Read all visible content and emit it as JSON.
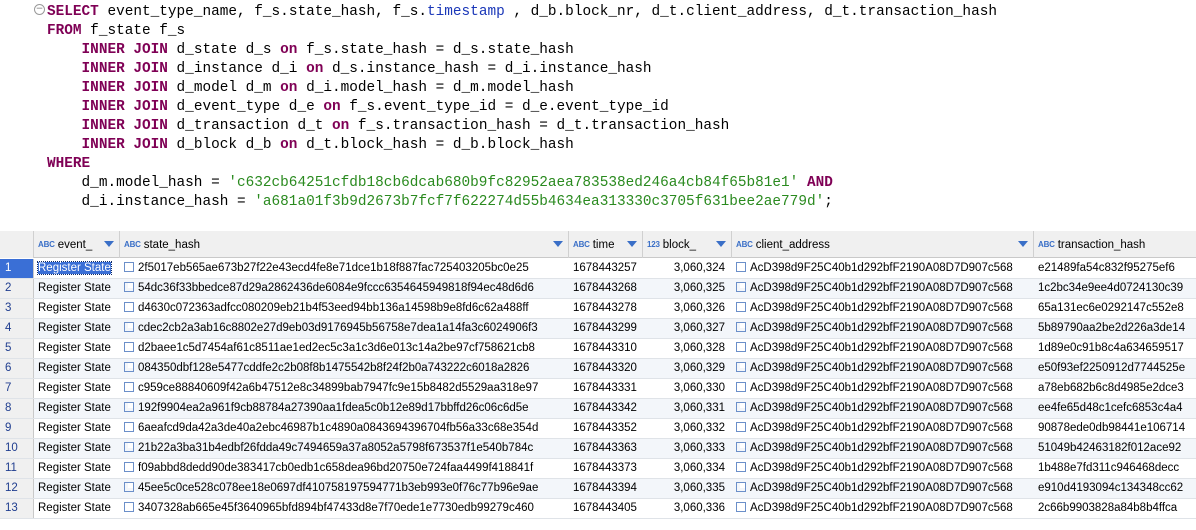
{
  "editor": {
    "lines": [
      [
        {
          "t": "SELECT",
          "c": "kw"
        },
        {
          "t": " event_type_name, f_s.state_hash, f_s."
        },
        {
          "t": "timestamp",
          "c": "fn"
        },
        {
          "t": " , d_b.block_nr, d_t.client_address, d_t.transaction_hash"
        }
      ],
      [
        {
          "t": "FROM",
          "c": "kw"
        },
        {
          "t": " f_state f_s"
        }
      ],
      [
        {
          "t": "    "
        },
        {
          "t": "INNER JOIN",
          "c": "kw"
        },
        {
          "t": " d_state d_s "
        },
        {
          "t": "on",
          "c": "kw"
        },
        {
          "t": " f_s.state_hash = d_s.state_hash"
        }
      ],
      [
        {
          "t": "    "
        },
        {
          "t": "INNER JOIN",
          "c": "kw"
        },
        {
          "t": " d_instance d_i "
        },
        {
          "t": "on",
          "c": "kw"
        },
        {
          "t": " d_s.instance_hash = d_i.instance_hash"
        }
      ],
      [
        {
          "t": "    "
        },
        {
          "t": "INNER JOIN",
          "c": "kw"
        },
        {
          "t": " d_model d_m "
        },
        {
          "t": "on",
          "c": "kw"
        },
        {
          "t": " d_i.model_hash = d_m.model_hash"
        }
      ],
      [
        {
          "t": "    "
        },
        {
          "t": "INNER JOIN",
          "c": "kw"
        },
        {
          "t": " d_event_type d_e "
        },
        {
          "t": "on",
          "c": "kw"
        },
        {
          "t": " f_s.event_type_id = d_e.event_type_id"
        }
      ],
      [
        {
          "t": "    "
        },
        {
          "t": "INNER JOIN",
          "c": "kw"
        },
        {
          "t": " d_transaction d_t "
        },
        {
          "t": "on",
          "c": "kw"
        },
        {
          "t": " f_s.transaction_hash = d_t.transaction_hash"
        }
      ],
      [
        {
          "t": "    "
        },
        {
          "t": "INNER JOIN",
          "c": "kw"
        },
        {
          "t": " d_block d_b "
        },
        {
          "t": "on",
          "c": "kw"
        },
        {
          "t": " d_t.block_hash = d_b.block_hash"
        }
      ],
      [
        {
          "t": "WHERE",
          "c": "kw"
        }
      ],
      [
        {
          "t": "    d_m.model_hash = "
        },
        {
          "t": "'c632cb64251cfdb18cb6dcab680b9fc82952aea783538ed246a4cb84f65b81e1'",
          "c": "str"
        },
        {
          "t": " "
        },
        {
          "t": "AND",
          "c": "kw"
        }
      ],
      [
        {
          "t": "    d_i.instance_hash = "
        },
        {
          "t": "'a681a01f3b9d2673b7fcf7f622274d55b4634ea313330c3705f631bee2ae779d'",
          "c": "str"
        },
        {
          "t": ";"
        }
      ]
    ]
  },
  "grid": {
    "columns": [
      {
        "type": "ABC",
        "label": "event_",
        "dropdown": true
      },
      {
        "type": "ABC",
        "label": "state_hash",
        "dropdown": true
      },
      {
        "type": "ABC",
        "label": "time",
        "dropdown": true
      },
      {
        "type": "123",
        "label": "block_",
        "dropdown": true
      },
      {
        "type": "ABC",
        "label": "client_address",
        "dropdown": true
      },
      {
        "type": "ABC",
        "label": "transaction_hash",
        "dropdown": false
      }
    ],
    "rows": [
      {
        "n": "1",
        "event": "Register State",
        "state": "2f5017eb565ae673b27f22e43ecd4fe8e71dce1b18f887fac725403205bc0e25",
        "time": "1678443257",
        "block": "3,060,324",
        "client": "AcD398d9F25C40b1d292bfF2190A08D7D907c568",
        "tx": "e21489fa54c832f95275ef6"
      },
      {
        "n": "2",
        "event": "Register State",
        "state": "54dc36f33bbedce87d29a2862436de6084e9fccc6354645949818f94ec48d6d6",
        "time": "1678443268",
        "block": "3,060,325",
        "client": "AcD398d9F25C40b1d292bfF2190A08D7D907c568",
        "tx": "1c2bc34e9ee4d0724130c39"
      },
      {
        "n": "3",
        "event": "Register State",
        "state": "d4630c072363adfcc080209eb21b4f53eed94bb136a14598b9e8fd6c62a488ff",
        "time": "1678443278",
        "block": "3,060,326",
        "client": "AcD398d9F25C40b1d292bfF2190A08D7D907c568",
        "tx": "65a131ec6e0292147c552e8"
      },
      {
        "n": "4",
        "event": "Register State",
        "state": "cdec2cb2a3ab16c8802e27d9eb03d9176945b56758e7dea1a14fa3c6024906f3",
        "time": "1678443299",
        "block": "3,060,327",
        "client": "AcD398d9F25C40b1d292bfF2190A08D7D907c568",
        "tx": "5b89790aa2be2d226a3de14"
      },
      {
        "n": "5",
        "event": "Register State",
        "state": "d2baee1c5d7454af61c8511ae1ed2ec5c3a1c3d6e013c14a2be97cf758621cb8",
        "time": "1678443310",
        "block": "3,060,328",
        "client": "AcD398d9F25C40b1d292bfF2190A08D7D907c568",
        "tx": "1d89e0c91b8c4a634659517"
      },
      {
        "n": "6",
        "event": "Register State",
        "state": "084350dbf128e5477cddfe2c2b08f8b1475542b8f24f2b0a743222c6018a2826",
        "time": "1678443320",
        "block": "3,060,329",
        "client": "AcD398d9F25C40b1d292bfF2190A08D7D907c568",
        "tx": "e50f93ef2250912d7744525e"
      },
      {
        "n": "7",
        "event": "Register State",
        "state": "c959ce88840609f42a6b47512e8c34899bab7947fc9e15b8482d5529aa318e97",
        "time": "1678443331",
        "block": "3,060,330",
        "client": "AcD398d9F25C40b1d292bfF2190A08D7D907c568",
        "tx": "a78eb682b6c8d4985e2dce3"
      },
      {
        "n": "8",
        "event": "Register State",
        "state": "192f9904ea2a961f9cb88784a27390aa1fdea5c0b12e89d17bbffd26c06c6d5e",
        "time": "1678443342",
        "block": "3,060,331",
        "client": "AcD398d9F25C40b1d292bfF2190A08D7D907c568",
        "tx": "ee4fe65d48c1cefc6853c4a4"
      },
      {
        "n": "9",
        "event": "Register State",
        "state": "6aeafcd9da42a3de40a2ebc46987b1c4890a0843694396704fb56a33c68e354d",
        "time": "1678443352",
        "block": "3,060,332",
        "client": "AcD398d9F25C40b1d292bfF2190A08D7D907c568",
        "tx": "90878ede0db98441e106714"
      },
      {
        "n": "10",
        "event": "Register State",
        "state": "21b22a3ba31b4edbf26fdda49c7494659a37a8052a5798f673537f1e540b784c",
        "time": "1678443363",
        "block": "3,060,333",
        "client": "AcD398d9F25C40b1d292bfF2190A08D7D907c568",
        "tx": "51049b42463182f012ace92"
      },
      {
        "n": "11",
        "event": "Register State",
        "state": "f09abbd8dedd90de383417cb0edb1c658dea96bd20750e724faa4499f418841f",
        "time": "1678443373",
        "block": "3,060,334",
        "client": "AcD398d9F25C40b1d292bfF2190A08D7D907c568",
        "tx": "1b488e7fd311c946468decc"
      },
      {
        "n": "12",
        "event": "Register State",
        "state": "45ee5c0ce528c078ee18e0697df410758197594771b3eb993e0f76c77b96e9ae",
        "time": "1678443394",
        "block": "3,060,335",
        "client": "AcD398d9F25C40b1d292bfF2190A08D7D907c568",
        "tx": "e910d4193094c134348cc62"
      },
      {
        "n": "13",
        "event": "Register State",
        "state": "3407328ab665e45f3640965bfd894bf47433d8e7f70ede1e7730edb99279c460",
        "time": "1678443405",
        "block": "3,060,336",
        "client": "AcD398d9F25C40b1d292bfF2190A08D7D907c568",
        "tx": "2c66b9903828a84b8b4ffca"
      }
    ]
  }
}
